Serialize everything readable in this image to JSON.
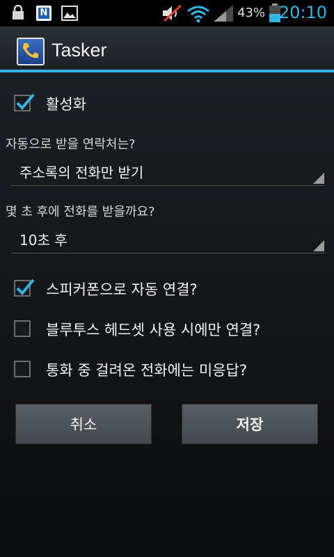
{
  "status_bar": {
    "icons": [
      "lock-icon",
      "notification-n-icon",
      "image-icon",
      "mute-icon",
      "wifi-icon",
      "signal-icon",
      "battery-icon"
    ],
    "battery_percent": "43%",
    "time": "20:10"
  },
  "header": {
    "title": "Tasker"
  },
  "enable": {
    "label": "활성화",
    "checked": true
  },
  "contacts": {
    "question": "자동으로 받을 연락처는?",
    "selected": "주소록의 전화만 받기"
  },
  "delay": {
    "question": "몇 초 후에 전화를 받을까요?",
    "selected": "10초 후"
  },
  "options": [
    {
      "label": "스피커폰으로 자동 연결?",
      "checked": true
    },
    {
      "label": "블루투스 헤드셋 사용 시에만 연결?",
      "checked": false
    },
    {
      "label": "통화 중 걸려온 전화에는 미응답?",
      "checked": false
    }
  ],
  "buttons": {
    "cancel": "취소",
    "save": "저장"
  },
  "colors": {
    "accent": "#33b5e5",
    "button": "#4f5358"
  }
}
